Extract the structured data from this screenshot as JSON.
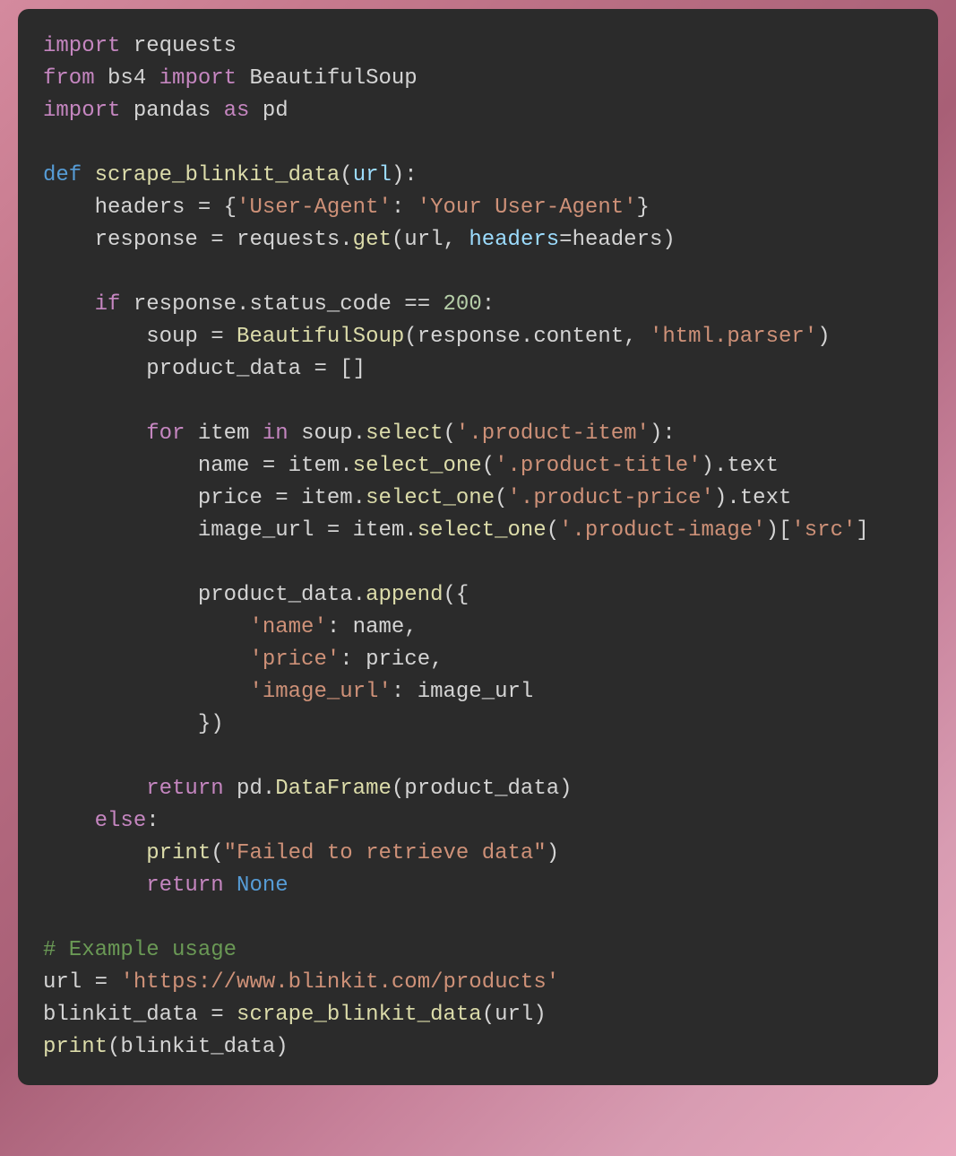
{
  "code": {
    "l1_kw1": "import",
    "l1_mod": "requests",
    "l2_kw1": "from",
    "l2_mod": "bs4",
    "l2_kw2": "import",
    "l2_cls": "BeautifulSoup",
    "l3_kw1": "import",
    "l3_mod": "pandas",
    "l3_kw2": "as",
    "l3_alias": "pd",
    "l5_def": "def",
    "l5_fn": "scrape_blinkit_data",
    "l5_param": "url",
    "l6_var": "headers",
    "l6_eq": "=",
    "l6_key": "'User-Agent'",
    "l6_val": "'Your User-Agent'",
    "l7_var": "response",
    "l7_eq": "=",
    "l7_obj": "requests",
    "l7_call": "get",
    "l7_arg1": "url",
    "l7_kwarg": "headers",
    "l7_kwval": "headers",
    "l9_if": "if",
    "l9_obj": "response",
    "l9_attr": "status_code",
    "l9_op": "==",
    "l9_num": "200",
    "l10_var": "soup",
    "l10_eq": "=",
    "l10_cls": "BeautifulSoup",
    "l10_arg1a": "response",
    "l10_arg1b": "content",
    "l10_arg2": "'html.parser'",
    "l11_var": "product_data",
    "l11_eq": "=",
    "l11_val": "[]",
    "l13_for": "for",
    "l13_item": "item",
    "l13_in": "in",
    "l13_obj": "soup",
    "l13_call": "select",
    "l13_arg": "'.product-item'",
    "l14_var": "name",
    "l14_eq": "=",
    "l14_obj": "item",
    "l14_call": "select_one",
    "l14_arg": "'.product-title'",
    "l14_attr": "text",
    "l15_var": "price",
    "l15_eq": "=",
    "l15_obj": "item",
    "l15_call": "select_one",
    "l15_arg": "'.product-price'",
    "l15_attr": "text",
    "l16_var": "image_url",
    "l16_eq": "=",
    "l16_obj": "item",
    "l16_call": "select_one",
    "l16_arg": "'.product-image'",
    "l16_key": "'src'",
    "l18_obj": "product_data",
    "l18_call": "append",
    "l19_key": "'name'",
    "l19_val": "name",
    "l20_key": "'price'",
    "l20_val": "price",
    "l21_key": "'image_url'",
    "l21_val": "image_url",
    "l24_ret": "return",
    "l24_obj": "pd",
    "l24_call": "DataFrame",
    "l24_arg": "product_data",
    "l25_else": "else",
    "l26_fn": "print",
    "l26_arg": "\"Failed to retrieve data\"",
    "l27_ret": "return",
    "l27_val": "None",
    "l29_cmt": "# Example usage",
    "l30_var": "url",
    "l30_eq": "=",
    "l30_val": "'https://www.blinkit.com/products'",
    "l31_var": "blinkit_data",
    "l31_eq": "=",
    "l31_fn": "scrape_blinkit_data",
    "l31_arg": "url",
    "l32_fn": "print",
    "l32_arg": "blinkit_data"
  }
}
